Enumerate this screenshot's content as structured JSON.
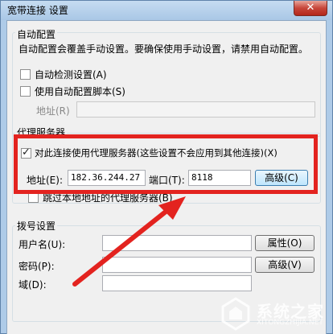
{
  "window": {
    "title": "宽带连接 设置",
    "close_glyph": "✕"
  },
  "auto_config": {
    "group_title": "自动配置",
    "description": "自动配置会覆盖手动设置。要确保使用手动设置，请禁用自动配置。",
    "auto_detect_label": "自动检测设置(A)",
    "auto_detect_checked": false,
    "use_script_label": "使用自动配置脚本(S)",
    "use_script_checked": false,
    "address_label": "地址(R)",
    "address_value": ""
  },
  "proxy": {
    "group_title": "代理服务器",
    "use_proxy_label": "对此连接使用代理服务器(这些设置不会应用到其他连接)(X)",
    "use_proxy_checked": true,
    "address_label": "地址(E):",
    "address_value": "182.36.244.27",
    "port_label": "端口(T):",
    "port_value": "8118",
    "advanced_label": "高级(C)",
    "bypass_label": "跳过本地地址的代理服务器(B)",
    "bypass_checked": false
  },
  "dialup": {
    "group_title": "拨号设置",
    "username_label": "用户名(U):",
    "username_value": "",
    "properties_label": "属性(O)",
    "password_label": "密码(P):",
    "password_value": "",
    "advanced_label": "高级(V)",
    "domain_label": "域(D):",
    "domain_value": ""
  },
  "watermark": {
    "brand": "系统之家",
    "sub": "XITONGZHIJIA.NET"
  },
  "colors": {
    "highlight": "#e3231f"
  }
}
